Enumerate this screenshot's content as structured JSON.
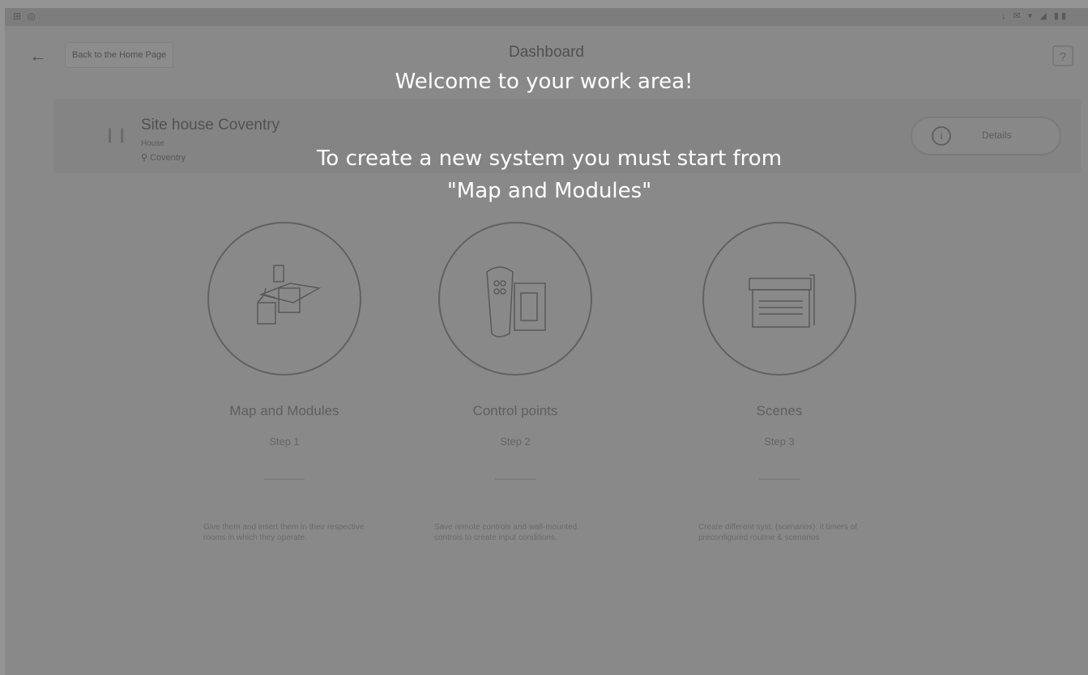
{
  "status_bar": {
    "left_icons": "⊞ ◎",
    "right_icons": "↓ ✉ ▾ ◢ ▮▮"
  },
  "header": {
    "back_label": "Back to the Home Page",
    "title": "Dashboard",
    "help_label": "?"
  },
  "site": {
    "name": "Site house Coventry",
    "type": "House",
    "city": "Coventry",
    "details_label": "Details"
  },
  "steps": [
    {
      "title": "Map and Modules",
      "step": "Step 1",
      "description": "Give them and insert them in their respective rooms in which they operate."
    },
    {
      "title": "Control points",
      "step": "Step 2",
      "description": "Save remote controls and wall-mounted controls to create input conditions."
    },
    {
      "title": "Scenes",
      "step": "Step 3",
      "description": "Create different syst. (scenarios): it timers of preconfigured routine & scenarios"
    }
  ],
  "tour": {
    "title": "Welcome to your work area!",
    "line1": "To create a new system you must start from",
    "line2": "\"Map and Modules\""
  },
  "colors": {
    "overlay": "#000000",
    "tour_text": "#ffffff"
  }
}
